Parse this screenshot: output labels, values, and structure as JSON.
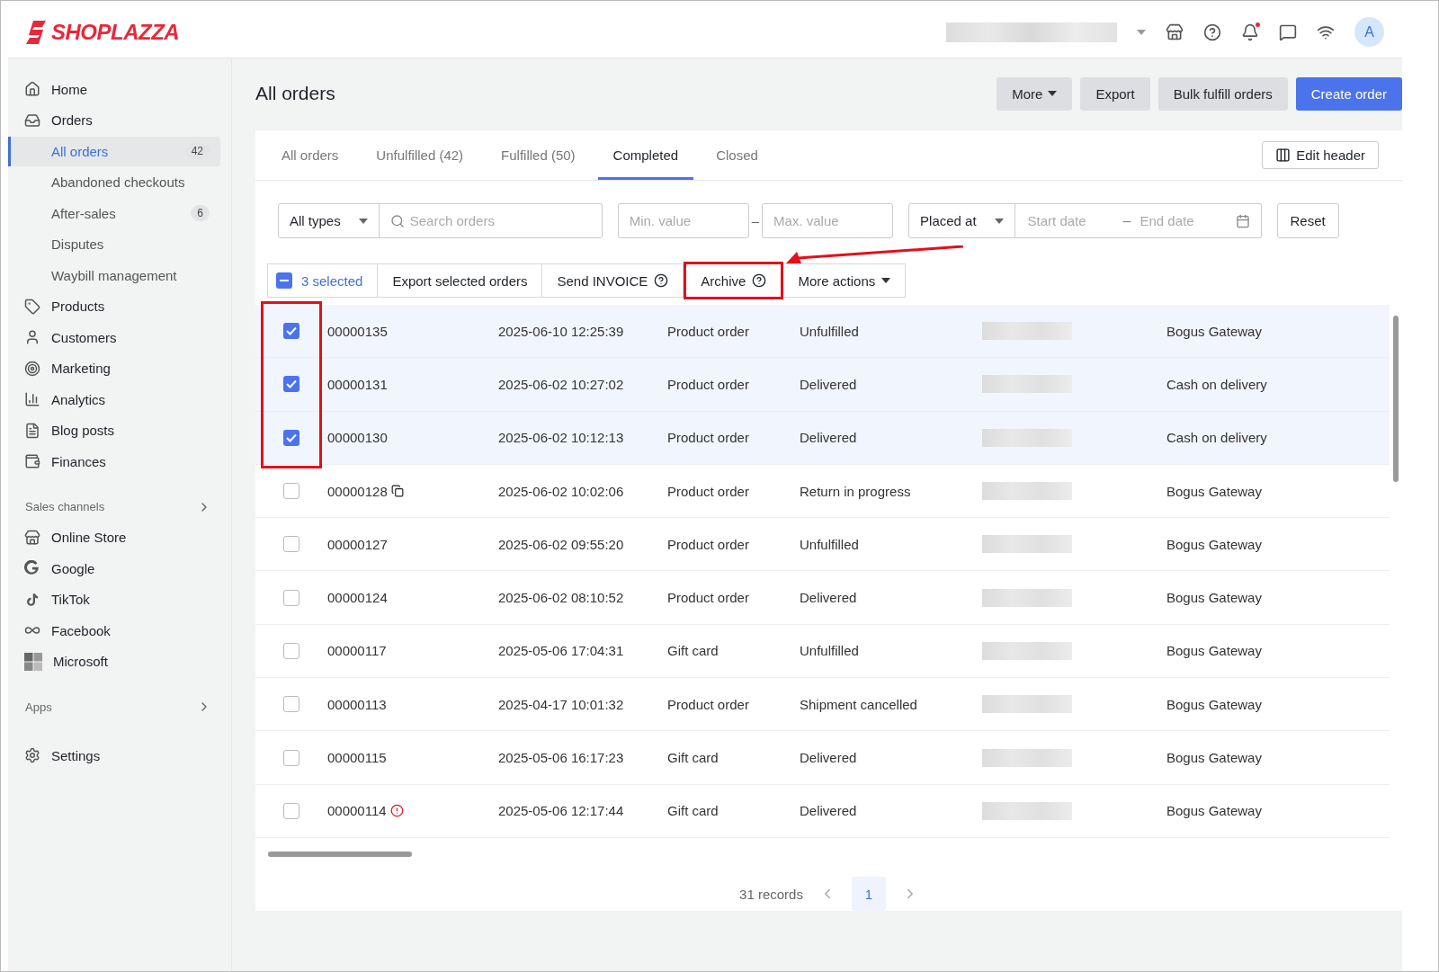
{
  "topbar": {
    "logo": "SHOPLAZZA",
    "avatar": "A"
  },
  "sidebar": {
    "items": [
      {
        "label": "Home",
        "selected": false
      },
      {
        "label": "Orders",
        "selected": false,
        "children": [
          {
            "label": "All orders",
            "selected": true,
            "badge": "42"
          },
          {
            "label": "Abandoned checkouts",
            "selected": false
          },
          {
            "label": "After-sales",
            "selected": false,
            "badge": "6"
          },
          {
            "label": "Disputes",
            "selected": false
          },
          {
            "label": "Waybill management",
            "selected": false
          }
        ]
      },
      {
        "label": "Products",
        "selected": false
      },
      {
        "label": "Customers",
        "selected": false
      },
      {
        "label": "Marketing",
        "selected": false
      },
      {
        "label": "Analytics",
        "selected": false
      },
      {
        "label": "Blog posts",
        "selected": false
      },
      {
        "label": "Finances",
        "selected": false
      }
    ],
    "sections": [
      {
        "title": "Sales channels",
        "items": [
          {
            "label": "Online Store",
            "selected": false
          },
          {
            "label": "Google",
            "selected": false
          },
          {
            "label": "TikTok",
            "selected": false
          },
          {
            "label": "Facebook",
            "selected": false
          },
          {
            "label": "Microsoft",
            "selected": false
          }
        ]
      },
      {
        "title": "Apps"
      }
    ],
    "footer_items": [
      {
        "label": "Settings",
        "selected": false
      }
    ]
  },
  "page": {
    "title": "All orders",
    "buttons": [
      {
        "label": "More",
        "kind": "menu"
      },
      {
        "label": "Export",
        "kind": "secondary"
      },
      {
        "label": "Bulk fulfill orders",
        "kind": "secondary"
      },
      {
        "label": "Create order",
        "kind": "primary"
      }
    ]
  },
  "tabs": [
    {
      "label": "All orders",
      "selected": false
    },
    {
      "label": "Unfulfilled (42)",
      "selected": false
    },
    {
      "label": "Fulfilled (50)",
      "selected": false
    },
    {
      "label": "Completed",
      "selected": true
    },
    {
      "label": "Closed",
      "selected": false
    }
  ],
  "edit_header": "Edit header",
  "filters": {
    "type": "All types",
    "search": {
      "placeholder": "Search orders"
    },
    "min": {
      "placeholder": "Min. value"
    },
    "value_separator": "–",
    "max": {
      "placeholder": "Max. value"
    },
    "date_field": "Placed at",
    "start": {
      "placeholder": "Start date"
    },
    "date_separator": "–",
    "end": {
      "placeholder": "End date"
    },
    "reset": "Reset"
  },
  "bulk_bar": {
    "some_selected": true,
    "selected_label": "3 selected",
    "actions": [
      {
        "label": "Export selected orders",
        "kind": "plain",
        "highlighted": false
      },
      {
        "label": "Send INVOICE",
        "kind": "help",
        "highlighted": false
      },
      {
        "label": "Archive",
        "kind": "help",
        "highlighted": true
      },
      {
        "label": "More actions",
        "kind": "menu",
        "highlighted": false
      }
    ]
  },
  "table": {
    "checkbox_highlight": true,
    "rows": [
      {
        "checked": true,
        "order": "00000135",
        "date": "2025-06-10 12:25:39",
        "type": "Product order",
        "status": "Unfulfilled",
        "payment": "Bogus Gateway"
      },
      {
        "checked": true,
        "order": "00000131",
        "date": "2025-06-02 10:27:02",
        "type": "Product order",
        "status": "Delivered",
        "payment": "Cash on delivery"
      },
      {
        "checked": true,
        "order": "00000130",
        "date": "2025-06-02 10:12:13",
        "type": "Product order",
        "status": "Delivered",
        "payment": "Cash on delivery"
      },
      {
        "checked": false,
        "order": "00000128",
        "date": "2025-06-02 10:02:06",
        "type": "Product order",
        "status": "Return in progress",
        "payment": "Bogus Gateway"
      },
      {
        "checked": false,
        "order": "00000127",
        "date": "2025-06-02 09:55:20",
        "type": "Product order",
        "status": "Unfulfilled",
        "payment": "Bogus Gateway"
      },
      {
        "checked": false,
        "order": "00000124",
        "date": "2025-06-02 08:10:52",
        "type": "Product order",
        "status": "Delivered",
        "payment": "Bogus Gateway"
      },
      {
        "checked": false,
        "order": "00000117",
        "date": "2025-05-06 17:04:31",
        "type": "Gift card",
        "status": "Unfulfilled",
        "payment": "Bogus Gateway"
      },
      {
        "checked": false,
        "order": "00000113",
        "date": "2025-04-17 10:01:32",
        "type": "Product order",
        "status": "Shipment cancelled",
        "payment": "Bogus Gateway"
      },
      {
        "checked": false,
        "order": "00000115",
        "date": "2025-05-06 16:17:23",
        "type": "Gift card",
        "status": "Delivered",
        "payment": "Bogus Gateway"
      },
      {
        "checked": false,
        "order": "00000114",
        "date": "2025-05-06 12:17:44",
        "type": "Gift card",
        "status": "Delivered",
        "payment": "Bogus Gateway"
      }
    ]
  },
  "pagination": {
    "records": "31 records",
    "pages": [
      {
        "label": "1",
        "selected": true
      }
    ]
  }
}
